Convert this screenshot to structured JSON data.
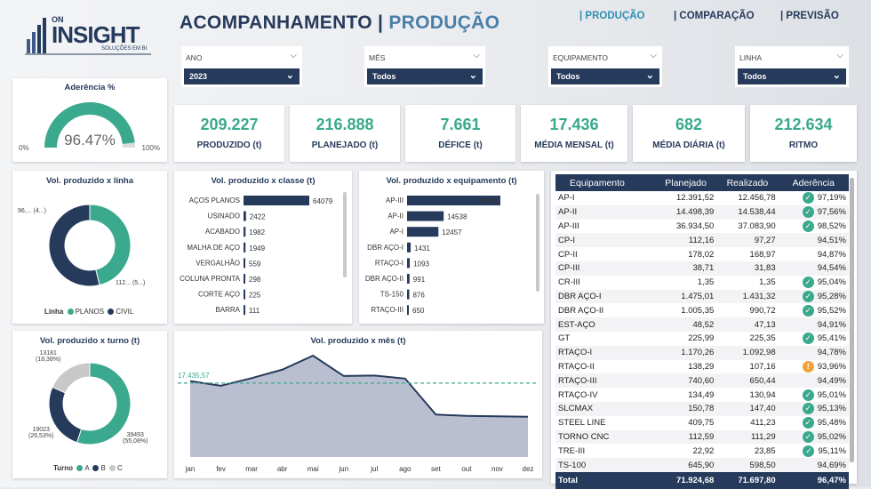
{
  "logo": {
    "top": "ON",
    "main": "INSIGHT",
    "sub": "SOLUÇÕES EM BI"
  },
  "header": {
    "title_a": "ACOMPANHAMENTO |",
    "title_b": "PRODUÇÃO"
  },
  "nav": [
    "| PRODUÇÃO",
    "| COMPARAÇÃO",
    "| PREVISÃO"
  ],
  "filters": [
    {
      "label": "ANO",
      "value": "2023"
    },
    {
      "label": "MÊS",
      "value": "Todos"
    },
    {
      "label": "EQUIPAMENTO",
      "value": "Todos"
    },
    {
      "label": "LINHA",
      "value": "Todos"
    }
  ],
  "aderencia": {
    "title": "Aderência %",
    "value": "96.47%",
    "min": "0%",
    "max": "100%",
    "fraction": 0.9647
  },
  "kpis": [
    {
      "value": "209.227",
      "label": "PRODUZIDO (t)"
    },
    {
      "value": "216.888",
      "label": "PLANEJADO (t)"
    },
    {
      "value": "7.661",
      "label": "DÉFICE (t)"
    },
    {
      "value": "17.436",
      "label": "MÉDIA MENSAL (t)"
    },
    {
      "value": "682",
      "label": "MÉDIA DIÁRIA (t)"
    },
    {
      "value": "212.634",
      "label": "RITMO"
    }
  ],
  "colors": {
    "navy": "#263a5c",
    "teal": "#3aa98d",
    "gray": "#c8c8c8"
  },
  "charts": {
    "linha": {
      "title": "Vol. produzido x linha",
      "label_a": "96,... (4...)",
      "label_b": "112... (5...)",
      "legend_title": "Linha",
      "legend": [
        "PLANOS",
        "CIVIL"
      ]
    },
    "classe": {
      "title": "Vol. produzido x classe (t)"
    },
    "equip": {
      "title": "Vol. produzido x equipamento (t)"
    },
    "turno": {
      "title": "Vol. produzido x turno (t)",
      "legend_title": "Turno",
      "legend": [
        "A",
        "B",
        "C"
      ],
      "labels": {
        "c": "13181",
        "c_pct": "(18,38%)",
        "b": "19023",
        "b_pct": "(26,53%)",
        "a": "39493",
        "a_pct": "(55,08%)"
      }
    },
    "mes": {
      "title": "Vol. produzido x mês (t)",
      "avg_label": "17.435,57"
    }
  },
  "chart_data": [
    {
      "type": "pie",
      "title": "Vol. produzido x linha",
      "categories": [
        "PLANOS",
        "CIVIL"
      ],
      "values": [
        96,
        112
      ]
    },
    {
      "type": "bar",
      "title": "Vol. produzido x classe (t)",
      "categories": [
        "AÇOS PLANOS",
        "USINADO",
        "ACABADO",
        "MALHA DE AÇO",
        "VERGALHÃO",
        "COLUNA PRONTA",
        "CORTE AÇO",
        "BARRA"
      ],
      "values": [
        64079,
        2422,
        1982,
        1949,
        559,
        298,
        225,
        111
      ]
    },
    {
      "type": "bar",
      "title": "Vol. produzido x equipamento (t)",
      "categories": [
        "AP-III",
        "AP-II",
        "AP-I",
        "DBR AÇO-I",
        "RTAÇO-I",
        "DBR AÇO-II",
        "TS-150",
        "RTAÇO-III"
      ],
      "values": [
        37084,
        14538,
        12457,
        1431,
        1093,
        991,
        876,
        650
      ]
    },
    {
      "type": "pie",
      "title": "Vol. produzido x turno (t)",
      "categories": [
        "A",
        "B",
        "C"
      ],
      "values": [
        39493,
        19023,
        13181
      ]
    },
    {
      "type": "area",
      "title": "Vol. produzido x mês (t)",
      "categories": [
        "jan",
        "fev",
        "mar",
        "abr",
        "mai",
        "jun",
        "jul",
        "ago",
        "set",
        "out",
        "nov",
        "dez"
      ],
      "values": [
        17900,
        16800,
        18600,
        20600,
        23900,
        19100,
        19200,
        18500,
        10000,
        9700,
        9600,
        9500
      ],
      "reference_line": 17435.57
    }
  ],
  "table": {
    "headers": [
      "Equipamento",
      "Planejado",
      "Realizado",
      "Aderência"
    ],
    "rows": [
      [
        "AP-I",
        "12.391,52",
        "12.456,78",
        "97,19%",
        "ok"
      ],
      [
        "AP-II",
        "14.498,39",
        "14.538,44",
        "97,56%",
        "ok"
      ],
      [
        "AP-III",
        "36.934,50",
        "37.083,90",
        "98,52%",
        "ok"
      ],
      [
        "CP-I",
        "112,16",
        "97,27",
        "94,51%",
        ""
      ],
      [
        "CP-II",
        "178,02",
        "168,97",
        "94,87%",
        ""
      ],
      [
        "CP-III",
        "38,71",
        "31,83",
        "94,54%",
        ""
      ],
      [
        "CR-III",
        "1,35",
        "1,35",
        "95,04%",
        "ok"
      ],
      [
        "DBR AÇO-I",
        "1.475,01",
        "1.431,32",
        "95,28%",
        "ok"
      ],
      [
        "DBR AÇO-II",
        "1.005,35",
        "990,72",
        "95,52%",
        "ok"
      ],
      [
        "EST-AÇO",
        "48,52",
        "47,13",
        "94,91%",
        ""
      ],
      [
        "GT",
        "225,99",
        "225,35",
        "95,41%",
        "ok"
      ],
      [
        "RTAÇO-I",
        "1.170,26",
        "1.092,98",
        "94,78%",
        ""
      ],
      [
        "RTAÇO-II",
        "138,29",
        "107,16",
        "93,96%",
        "warn"
      ],
      [
        "RTAÇO-III",
        "740,60",
        "650,44",
        "94,49%",
        ""
      ],
      [
        "RTAÇO-IV",
        "134,49",
        "130,94",
        "95,01%",
        "ok"
      ],
      [
        "SLCMAX",
        "150,78",
        "147,40",
        "95,13%",
        "ok"
      ],
      [
        "STEEL LINE",
        "409,75",
        "411,23",
        "95,48%",
        "ok"
      ],
      [
        "TORNO CNC",
        "112,59",
        "111,29",
        "95,02%",
        "ok"
      ],
      [
        "TRE-III",
        "22,92",
        "23,85",
        "95,11%",
        "ok"
      ],
      [
        "TS-100",
        "645,90",
        "598,50",
        "94,69%",
        ""
      ]
    ],
    "total": [
      "Total",
      "71.924,68",
      "71.697,80",
      "96,47%"
    ]
  }
}
